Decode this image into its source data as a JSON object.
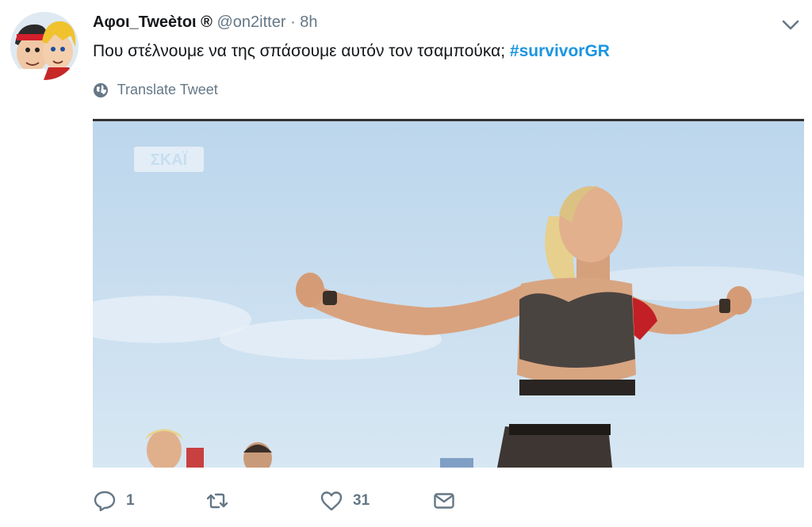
{
  "tweet": {
    "author_name": "Αφοι_Tweètοι ®",
    "handle": "@on2itter",
    "separator": "·",
    "time": "8h",
    "text": "Που στέλνουμε να της σπάσουμε αυτόν τον τσαμπούκα;",
    "hashtag": "#survivorGR",
    "translate_label": "Translate Tweet"
  },
  "media": {
    "channel_logo": "ΣΚΑΪ"
  },
  "actions": {
    "reply_count": "1",
    "retweet_count": "",
    "like_count": "31"
  },
  "colors": {
    "link": "#1b95e0",
    "muted": "#657786",
    "text": "#14171a",
    "sky": "#c7def0"
  },
  "icons": [
    "avatar-image",
    "chevron-down-icon",
    "globe-icon",
    "reply-icon",
    "retweet-icon",
    "like-icon",
    "direct-message-icon"
  ]
}
